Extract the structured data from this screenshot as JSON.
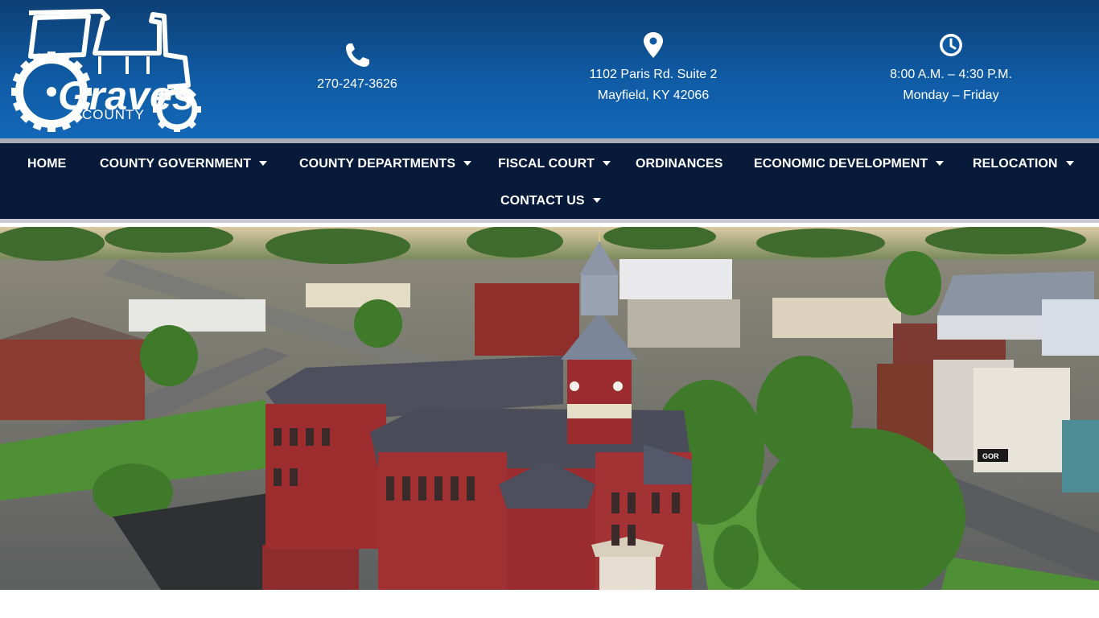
{
  "logo": {
    "brand": "Graves",
    "sub": "COUNTY",
    "icon": "tractor-gear-logo"
  },
  "contact": {
    "phone": {
      "icon": "phone-icon",
      "line1": "270-247-3626"
    },
    "address": {
      "icon": "map-pin-icon",
      "line1": "1102 Paris Rd. Suite 2",
      "line2": "Mayfield, KY 42066"
    },
    "hours": {
      "icon": "clock-icon",
      "line1": "8:00 A.M. – 4:30 P.M.",
      "line2": "Monday – Friday"
    }
  },
  "nav": {
    "items": [
      {
        "label": "HOME",
        "dropdown": false
      },
      {
        "label": "COUNTY GOVERNMENT",
        "dropdown": true
      },
      {
        "label": "COUNTY DEPARTMENTS",
        "dropdown": true
      },
      {
        "label": "FISCAL COURT",
        "dropdown": true
      },
      {
        "label": "ORDINANCES",
        "dropdown": false
      },
      {
        "label": "ECONOMIC DEVELOPMENT",
        "dropdown": true
      },
      {
        "label": "RELOCATION",
        "dropdown": true
      },
      {
        "label": "CONTACT US",
        "dropdown": true
      }
    ]
  },
  "hero": {
    "store_sign": "GOR",
    "colors": {
      "brick": "#9e2d2f",
      "roof": "#4d4f5c",
      "sky": "#e8d7b8",
      "grass": "#4f8f36",
      "tree": "#3e7a2a"
    }
  },
  "colors": {
    "header_top": "#0d3f74",
    "header_bottom": "#1468b8",
    "nav_bg": "#071a3a",
    "separator": "#a9aeb6"
  }
}
